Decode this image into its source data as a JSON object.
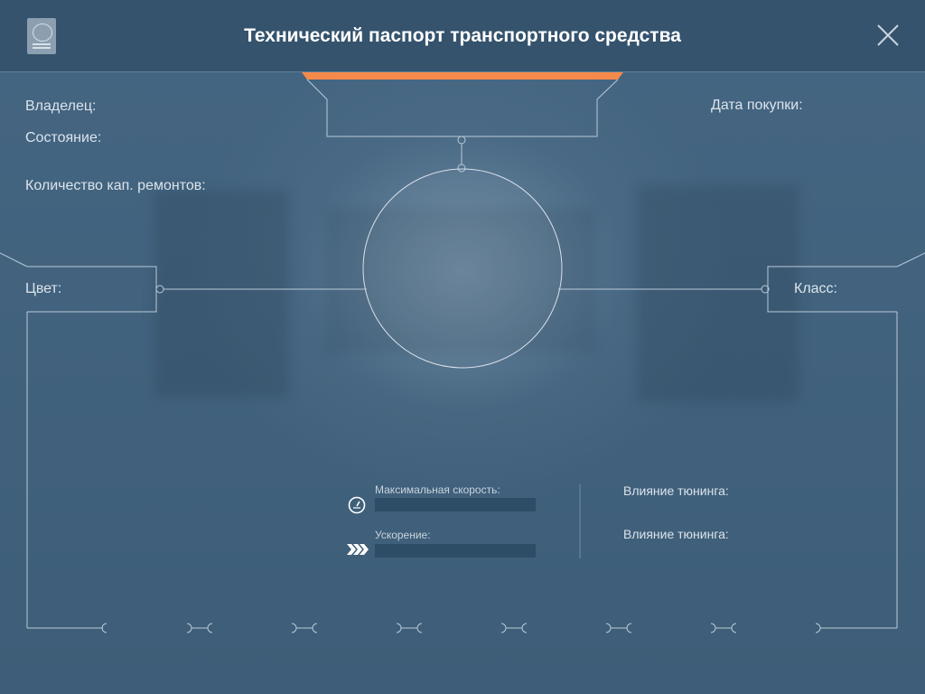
{
  "header": {
    "title": "Технический паспорт транспортного средства"
  },
  "fields": {
    "owner": "Владелец:",
    "purchase_date": "Дата покупки:",
    "condition": "Состояние:",
    "repairs": "Количество кап. ремонтов:",
    "color": "Цвет:",
    "class": "Класс:"
  },
  "stats": {
    "max_speed_label": "Максимальная скорость:",
    "acceleration_label": "Ускорение:",
    "max_speed_fill": 0,
    "acceleration_fill": 0,
    "tuning_speed_label": "Влияние тюнинга:",
    "tuning_accel_label": "Влияние тюнинга:"
  },
  "colors": {
    "accent": "#f58a4b",
    "line": "#b9cad8"
  },
  "icons": {
    "emblem": "emblem-icon",
    "close": "close-icon",
    "speedometer": "speedometer-icon",
    "acceleration": "chevrons-right-icon"
  }
}
